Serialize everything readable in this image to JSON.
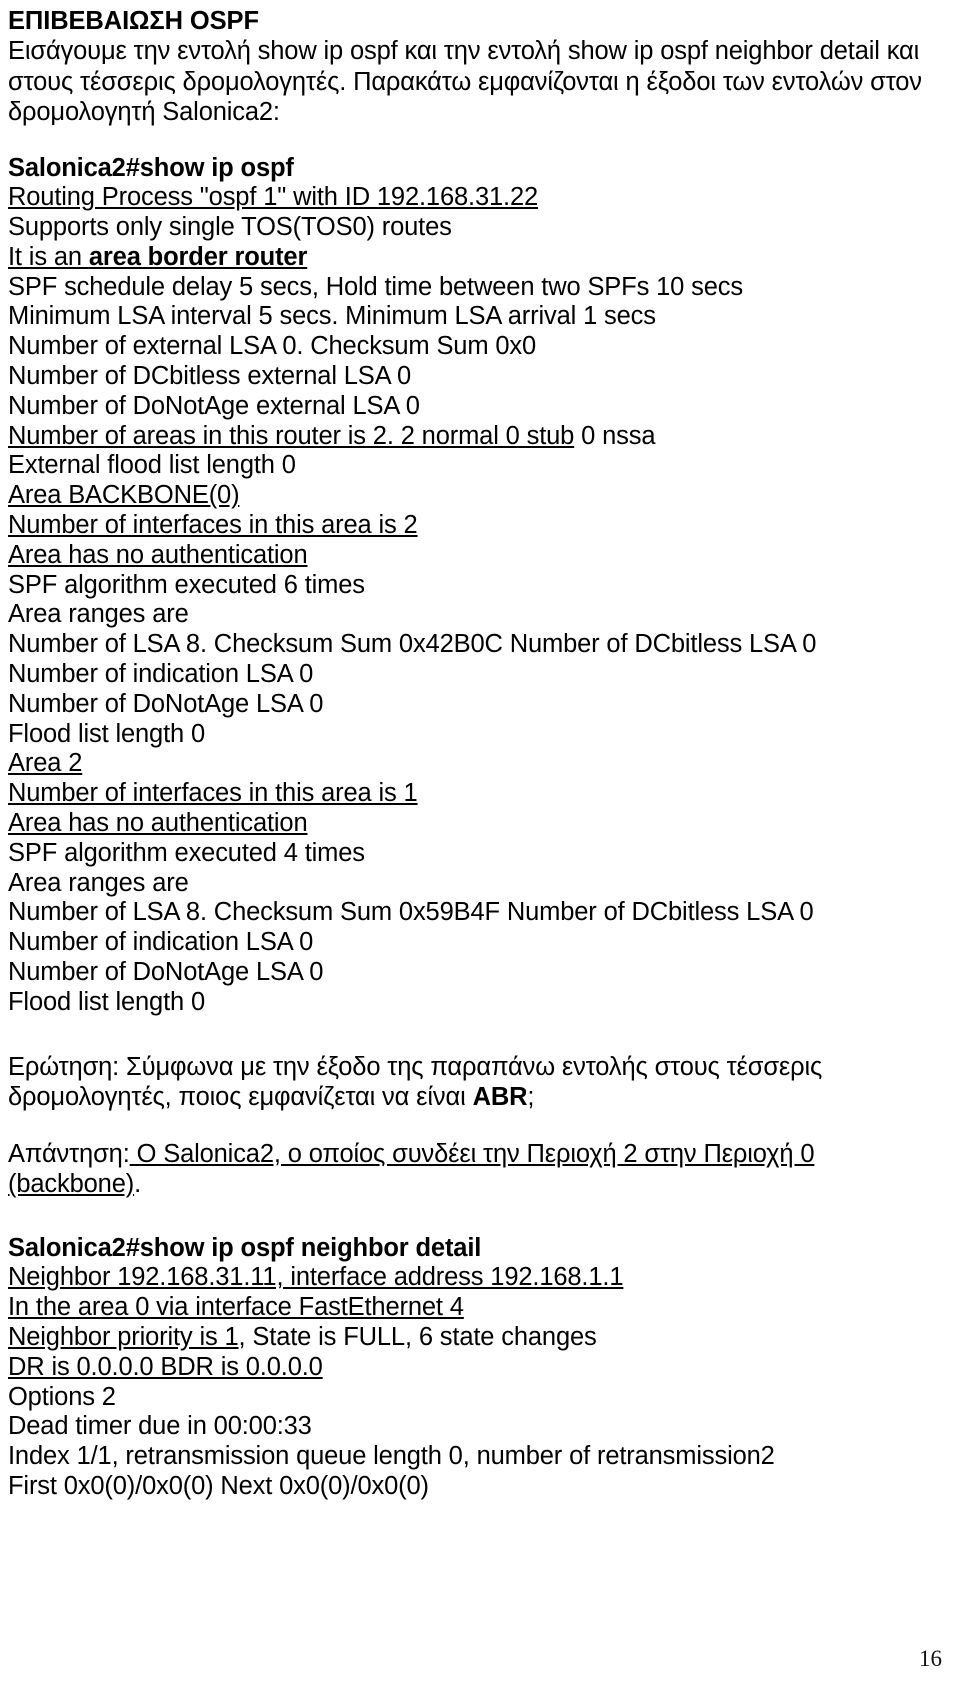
{
  "document": {
    "heading": "ΕΠΙΒΕΒΑΙΩΣΗ OSPF",
    "intro_paragraph": "Εισάγουμε την εντολή show ip ospf και την εντολή show ip ospf neighbor detail και στους τέσσερις δρομολογητές. Παρακάτω εμφανίζονται η έξοδοι των εντολών στον δρομολογητή Salonica2:",
    "page_number": "16"
  },
  "command_block_1": {
    "prompt": "Salonica2#show ip ospf",
    "lines": [
      {
        "text": "Routing Process \"ospf 1\" with ID 192.168.31.22",
        "underline": true
      },
      {
        "text": "Supports only single TOS(TOS0) routes",
        "underline": false
      },
      {
        "prefix": "It is an ",
        "bold": "area border router",
        "underline": true
      },
      {
        "text": "SPF schedule delay 5 secs, Hold time between two SPFs 10 secs",
        "underline": false
      },
      {
        "text": "Minimum LSA interval 5 secs. Minimum LSA arrival 1 secs",
        "underline": false
      },
      {
        "text": "Number of external LSA 0. Checksum Sum 0x0",
        "underline": false
      },
      {
        "text": "Number of DCbitless external LSA 0",
        "underline": false
      },
      {
        "text": "Number of DoNotAge external LSA 0",
        "underline": false
      },
      {
        "underlined_part": "Number of areas in this router is 2. 2 normal 0 stub",
        "plain_tail": " 0 nssa"
      },
      {
        "text": "External flood list length 0",
        "underline": false
      },
      {
        "text": "Area BACKBONE(0)",
        "underline": true
      },
      {
        "text": "Number of interfaces in this area is 2",
        "underline": true
      },
      {
        "text": "Area has no authentication",
        "underline": true
      },
      {
        "text": "SPF algorithm executed 6 times",
        "underline": false
      },
      {
        "text": "Area ranges are",
        "underline": false
      },
      {
        "text": "Number of LSA 8. Checksum Sum 0x42B0C Number of DCbitless LSA 0",
        "underline": false
      },
      {
        "text": "Number of indication LSA 0",
        "underline": false
      },
      {
        "text": "Number of DoNotAge LSA 0",
        "underline": false
      },
      {
        "text": "Flood list length 0",
        "underline": false
      },
      {
        "text": "Area 2",
        "underline": true
      },
      {
        "text": "Number of interfaces in this area is 1",
        "underline": true
      },
      {
        "text": "Area has no authentication",
        "underline": true
      },
      {
        "text": "SPF algorithm executed 4 times",
        "underline": false
      },
      {
        "text": "Area ranges are",
        "underline": false
      },
      {
        "text": "Number of LSA 8. Checksum Sum 0x59B4F Number of DCbitless LSA 0",
        "underline": false
      },
      {
        "text": "Number of indication LSA 0",
        "underline": false
      },
      {
        "text": "Number of DoNotAge LSA 0",
        "underline": false
      },
      {
        "text": "Flood list length 0",
        "underline": false
      }
    ]
  },
  "qa": {
    "question_label": "Ερώτηση:",
    "question_text_1": " Σύμφωνα με την έξοδο της παραπάνω εντολής στους τέσσερις δρομολογητές, ποιος εμφανίζεται να είναι ",
    "question_bold": "ABR",
    "question_text_2": ";",
    "answer_label": "Απάντηση:",
    "answer_underlined": " Ο Salonica2, ο οποίος συνδέει την Περιοχή 2 στην Περιοχή 0 (backbone)",
    "answer_tail": "."
  },
  "command_block_2": {
    "prompt": "Salonica2#show ip ospf neighbor detail",
    "lines": [
      {
        "text": "Neighbor 192.168.31.11, interface address 192.168.1.1",
        "underline": true
      },
      {
        "text": "In the area 0 via interface FastEthernet 4",
        "underline": true
      },
      {
        "underlined_part": "Neighbor priority is 1",
        "plain_tail": ", State is FULL, 6 state changes"
      },
      {
        "text": "DR is 0.0.0.0 BDR is 0.0.0.0",
        "underline": true
      },
      {
        "text": "Options 2",
        "underline": false
      },
      {
        "text": "Dead timer due in 00:00:33",
        "underline": false
      },
      {
        "text": "Index 1/1, retransmission queue length 0, number of retransmission2",
        "underline": false
      },
      {
        "text": "First 0x0(0)/0x0(0) Next 0x0(0)/0x0(0)",
        "underline": false
      }
    ]
  }
}
